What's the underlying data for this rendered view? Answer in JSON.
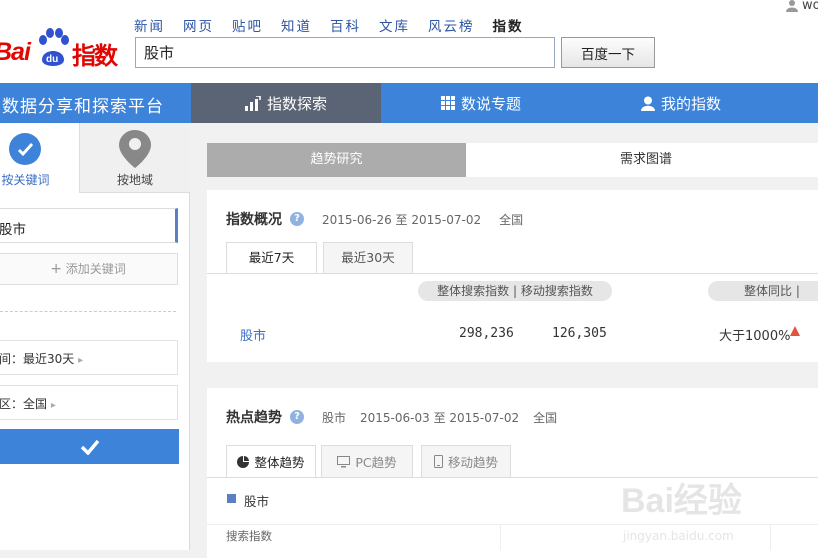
{
  "header": {
    "nav": [
      "新闻",
      "网页",
      "贴吧",
      "知道",
      "百科",
      "文库",
      "风云榜",
      "指数"
    ],
    "active_nav": "指数",
    "logo_text_left": "Bai",
    "logo_text_paw": "du",
    "logo_text_right": "指数",
    "user_name": "wo",
    "search_value": "股市",
    "search_button": "百度一下"
  },
  "mainnav": {
    "platform_title": "数据分享和探索平台",
    "tabs": [
      {
        "label": "指数探索",
        "icon": "chart-icon"
      },
      {
        "label": "数说专题",
        "icon": "grid-icon"
      },
      {
        "label": "我的指数",
        "icon": "user-icon"
      }
    ]
  },
  "sidebar": {
    "tab_keyword": "按关键词",
    "tab_region": "按地域",
    "keyword": "股市",
    "add_keyword": "添加关键词",
    "time_filter": "间：最近30天",
    "region_filter": "区：全国"
  },
  "content_tabs": [
    "趋势研究",
    "需求图谱"
  ],
  "overview": {
    "title": "指数概况",
    "date_range": "2015-06-26 至 2015-07-02",
    "region": "全国",
    "tabs": [
      "最近7天",
      "最近30天"
    ],
    "header_pill": "整体搜索指数 | 移动搜索指数",
    "yoy_pill": "整体同比 |",
    "row": {
      "keyword": "股市",
      "total": "298,236",
      "mobile": "126,305",
      "yoy": "大于1000%"
    }
  },
  "trend": {
    "title": "热点趋势",
    "keyword": "股市",
    "date_range": "2015-06-03 至 2015-07-02",
    "region": "全国",
    "tabs": [
      "整体趋势",
      "PC趋势",
      "移动趋势"
    ],
    "legend": "股市",
    "y_label": "搜索指数"
  },
  "watermark": {
    "text": "Bai经验",
    "sub": "jingyan.baidu.com"
  },
  "colors": {
    "brand_red": "#e10602",
    "nav_blue": "#3d83d9",
    "active_nav": "#5b6474",
    "link_blue": "#3b6ec7",
    "up_red": "#e0563c"
  }
}
